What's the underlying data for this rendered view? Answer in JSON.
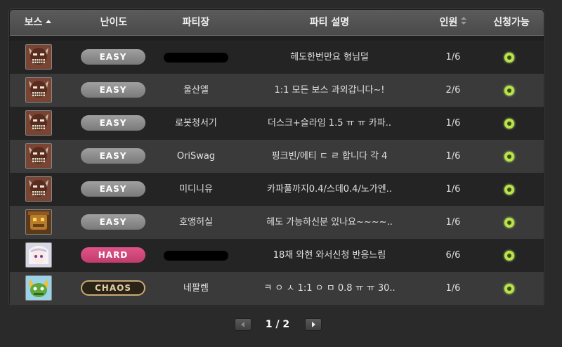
{
  "header": {
    "boss": "보스",
    "difficulty": "난이도",
    "leader": "파티장",
    "description": "파티 설명",
    "members": "인원",
    "available": "신청가능"
  },
  "rows": [
    {
      "boss_icon": "zakum-icon",
      "difficulty": "EASY",
      "leader": "",
      "leader_redacted": true,
      "description": "헤도한번만요 형님덜",
      "members": "1/6"
    },
    {
      "boss_icon": "zakum-icon",
      "difficulty": "EASY",
      "leader": "울산엘",
      "leader_redacted": false,
      "description": "1:1 모든 보스 과외갑니다~!",
      "members": "2/6"
    },
    {
      "boss_icon": "zakum-icon",
      "difficulty": "EASY",
      "leader": "로봇청서기",
      "leader_redacted": false,
      "description": "더스크+슬라임 1.5 ㅠ ㅠ 카파..",
      "members": "1/6"
    },
    {
      "boss_icon": "zakum-icon",
      "difficulty": "EASY",
      "leader": "OriSwag",
      "leader_redacted": false,
      "description": "핑크빈/에티 ㄷ ㄹ 합니다 각 4",
      "members": "1/6"
    },
    {
      "boss_icon": "zakum-icon",
      "difficulty": "EASY",
      "leader": "미디니유",
      "leader_redacted": false,
      "description": "카파풀까지0.4/스데0.4/노가엔..",
      "members": "1/6"
    },
    {
      "boss_icon": "golem-icon",
      "difficulty": "EASY",
      "leader": "호앵허실",
      "leader_redacted": false,
      "description": "헤도 가능하신분 있나요~~~~..",
      "members": "1/6"
    },
    {
      "boss_icon": "lucid-icon",
      "difficulty": "HARD",
      "leader": "",
      "leader_redacted": true,
      "description": "18채 와현 와서신청 반응느림",
      "members": "6/6"
    },
    {
      "boss_icon": "horntail-icon",
      "difficulty": "CHAOS",
      "leader": "네팔렘",
      "leader_redacted": false,
      "description": "ㅋ ㅇ ㅅ 1:1 ㅇ ㅁ 0.8 ㅠ ㅠ 30..",
      "members": "1/6"
    }
  ],
  "pager": {
    "text": "1 / 2"
  },
  "colors": {
    "easy": "#8c8c8c",
    "hard": "#d0487a",
    "chaos_border": "#c7a977",
    "available": "#b8e34a"
  }
}
